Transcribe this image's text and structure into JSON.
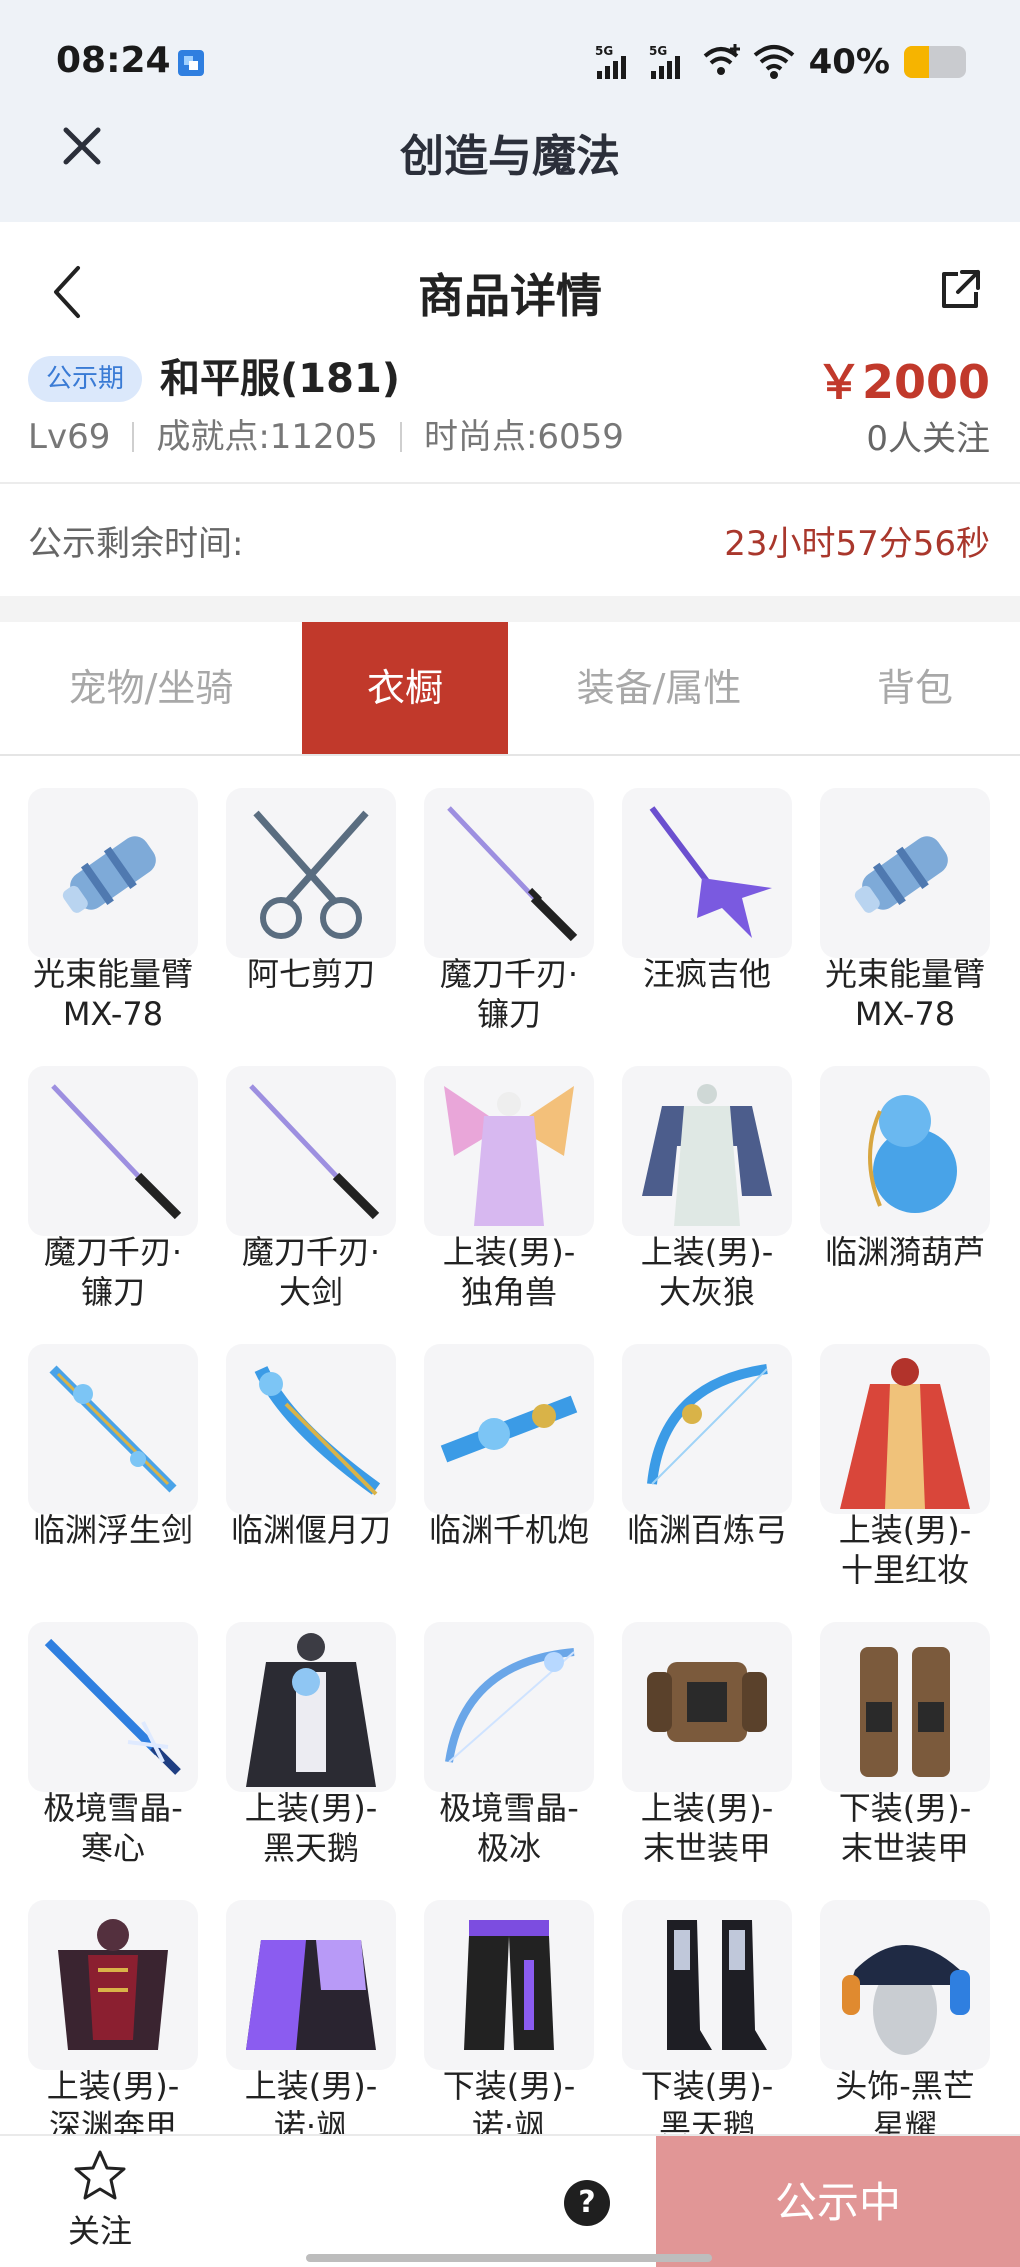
{
  "status_bar": {
    "time": "08:24",
    "battery": "40%",
    "battery_level": 0.4,
    "icons": [
      "5g-signal-icon",
      "5g-signal-icon",
      "wifi-plus-icon",
      "wifi-icon",
      "battery-icon"
    ]
  },
  "app": {
    "title": "创造与魔法",
    "close_icon": "close-icon"
  },
  "page": {
    "title": "商品详情",
    "back_icon": "chevron-left-icon",
    "share_icon": "share-icon"
  },
  "item": {
    "badge": "公示期",
    "name": "和平服(181)",
    "price": "￥2000",
    "level": "Lv69",
    "achievement": "成就点:11205",
    "fashion": "时尚点:6059",
    "followers": "0人关注"
  },
  "countdown": {
    "label": "公示剩余时间:",
    "value": "23小时57分56秒"
  },
  "tabs": [
    {
      "label": "宠物/坐骑",
      "active": false
    },
    {
      "label": "衣橱",
      "active": true
    },
    {
      "label": "装备/属性",
      "active": false
    },
    {
      "label": "背包",
      "active": false
    }
  ],
  "wardrobe": [
    {
      "line1": "光束能量臂",
      "line2": "MX-78",
      "icon": "beam-arm-icon"
    },
    {
      "line1": "阿七剪刀",
      "line2": "",
      "icon": "scissors-icon"
    },
    {
      "line1": "魔刀千刃·",
      "line2": "镰刀",
      "icon": "katana-icon"
    },
    {
      "line1": "汪疯吉他",
      "line2": "",
      "icon": "guitar-icon"
    },
    {
      "line1": "光束能量臂",
      "line2": "MX-78",
      "icon": "beam-arm-icon"
    },
    {
      "line1": "魔刀千刃·",
      "line2": "镰刀",
      "icon": "katana-icon"
    },
    {
      "line1": "魔刀千刃·",
      "line2": "大剑",
      "icon": "katana-icon"
    },
    {
      "line1": "上装(男)-",
      "line2": "独角兽",
      "icon": "winged-outfit-icon"
    },
    {
      "line1": "上装(男)-",
      "line2": "大灰狼",
      "icon": "apron-outfit-icon"
    },
    {
      "line1": "临渊漪葫芦",
      "line2": "",
      "icon": "water-gourd-icon"
    },
    {
      "line1": "临渊浮生剑",
      "line2": "",
      "icon": "water-sword-icon"
    },
    {
      "line1": "临渊偃月刀",
      "line2": "",
      "icon": "water-blade-icon"
    },
    {
      "line1": "临渊千机炮",
      "line2": "",
      "icon": "water-cannon-icon"
    },
    {
      "line1": "临渊百炼弓",
      "line2": "",
      "icon": "water-bow-icon"
    },
    {
      "line1": "上装(男)-",
      "line2": "十里红妆",
      "icon": "red-robe-icon"
    },
    {
      "line1": "极境雪晶-",
      "line2": "寒心",
      "icon": "ice-sword-icon"
    },
    {
      "line1": "上装(男)-",
      "line2": "黑天鹅",
      "icon": "dark-coat-icon"
    },
    {
      "line1": "极境雪晶-",
      "line2": "极冰",
      "icon": "ice-bow-icon"
    },
    {
      "line1": "上装(男)-",
      "line2": "末世装甲",
      "icon": "mech-armor-icon"
    },
    {
      "line1": "下装(男)-",
      "line2": "末世装甲",
      "icon": "mech-legs-icon"
    },
    {
      "line1": "上装(男)-",
      "line2": "深渊奔甲",
      "icon": "abyss-armor-icon"
    },
    {
      "line1": "上装(男)-",
      "line2": "诺·飒",
      "icon": "purple-jacket-icon"
    },
    {
      "line1": "下装(男)-",
      "line2": "诺·飒",
      "icon": "purple-pants-icon"
    },
    {
      "line1": "下装(男)-",
      "line2": "黑天鹅",
      "icon": "boots-icon"
    },
    {
      "line1": "头饰-黑芒",
      "line2": "星耀",
      "icon": "cap-headphones-icon"
    }
  ],
  "bottom_bar": {
    "follow_label": "关注",
    "help_icon": "help-icon",
    "help_glyph": "?",
    "cta_label": "公示中"
  },
  "colors": {
    "accent_red": "#c1392b",
    "badge_blue": "#3a7bd5",
    "cta_pink": "#e19696"
  }
}
